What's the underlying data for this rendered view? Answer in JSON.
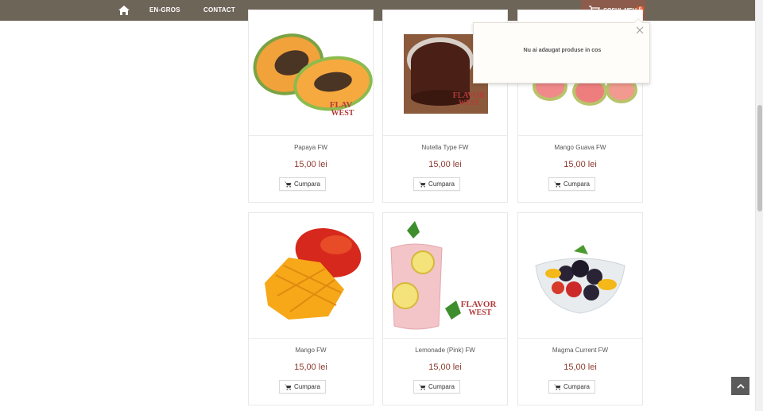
{
  "nav": {
    "home_icon": "home-icon",
    "links": [
      "EN-GROS",
      "CONTACT"
    ],
    "cart": {
      "label": "COSUL MEU",
      "count": "0",
      "icon": "cart-icon"
    }
  },
  "cart_popup": {
    "message": "Nu ai adaugat produse in cos",
    "close_icon": "close-icon"
  },
  "products": [
    {
      "name": "Papaya FW",
      "price": "15,00 lei",
      "button": "Cumpara"
    },
    {
      "name": "Nutella Type FW",
      "price": "15,00 lei",
      "button": "Cumpara"
    },
    {
      "name": "Mango Guava FW",
      "price": "15,00 lei",
      "button": "Cumpara"
    },
    {
      "name": "Mango FW",
      "price": "15,00 lei",
      "button": "Cumpara"
    },
    {
      "name": "Lemonade (Pink) FW",
      "price": "15,00 lei",
      "button": "Cumpara"
    },
    {
      "name": "Magma Current FW",
      "price": "15,00 lei",
      "button": "Cumpara"
    }
  ],
  "product_images": {
    "brand_logo_text": "FLAVOR WEST"
  },
  "colors": {
    "nav_bg": "#6e6559",
    "cart_bg": "#8c5b4c",
    "price": "#8b3a2d",
    "badge": "#e0592f"
  }
}
